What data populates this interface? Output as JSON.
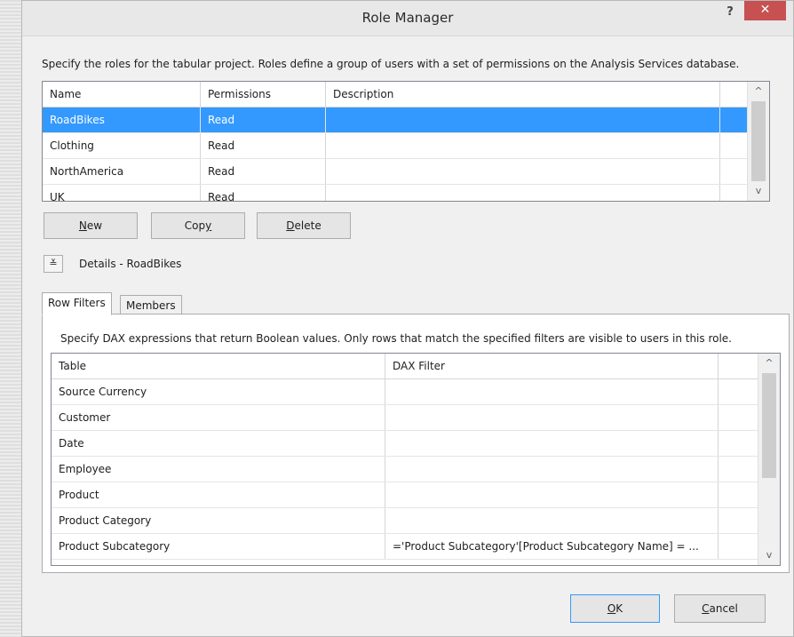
{
  "window": {
    "title": "Role Manager",
    "help_label": "?",
    "close_label": "✕"
  },
  "intro_text": "Specify the roles for the tabular project. Roles define a group of users with a set of permissions on the Analysis Services database.",
  "roles_grid": {
    "columns": [
      "Name",
      "Permissions",
      "Description"
    ],
    "rows": [
      {
        "name": "RoadBikes",
        "permissions": "Read",
        "description": "",
        "selected": true
      },
      {
        "name": "Clothing",
        "permissions": "Read",
        "description": ""
      },
      {
        "name": "NorthAmerica",
        "permissions": "Read",
        "description": ""
      },
      {
        "name": "UK",
        "permissions": "Read",
        "description": ""
      }
    ]
  },
  "role_buttons": {
    "new_access": "N",
    "new_rest": "ew",
    "copy_start": "Cop",
    "copy_access": "y",
    "delete_access": "D",
    "delete_rest": "elete"
  },
  "details": {
    "toggle_icon": "chevron-double-down-icon",
    "toggle_glyph": "≚",
    "label": "Details - RoadBikes"
  },
  "tabs": [
    {
      "label": "Row Filters",
      "active": true
    },
    {
      "label": "Members",
      "active": false
    }
  ],
  "row_filters": {
    "intro_text": "Specify DAX expressions that return Boolean values. Only rows that match the specified filters are visible to users in this role.",
    "columns": [
      "Table",
      "DAX Filter"
    ],
    "rows": [
      {
        "table": "Source Currency",
        "filter": ""
      },
      {
        "table": "Customer",
        "filter": ""
      },
      {
        "table": "Date",
        "filter": ""
      },
      {
        "table": "Employee",
        "filter": ""
      },
      {
        "table": "Product",
        "filter": ""
      },
      {
        "table": "Product Category",
        "filter": ""
      },
      {
        "table": "Product Subcategory",
        "filter": "='Product Subcategory'[Product Subcategory Name] = ..."
      }
    ]
  },
  "dialog_buttons": {
    "ok_access": "O",
    "ok_rest": "K",
    "cancel_access": "C",
    "cancel_rest": "ancel"
  },
  "scroll": {
    "up_glyph": "^",
    "down_glyph": "v"
  }
}
